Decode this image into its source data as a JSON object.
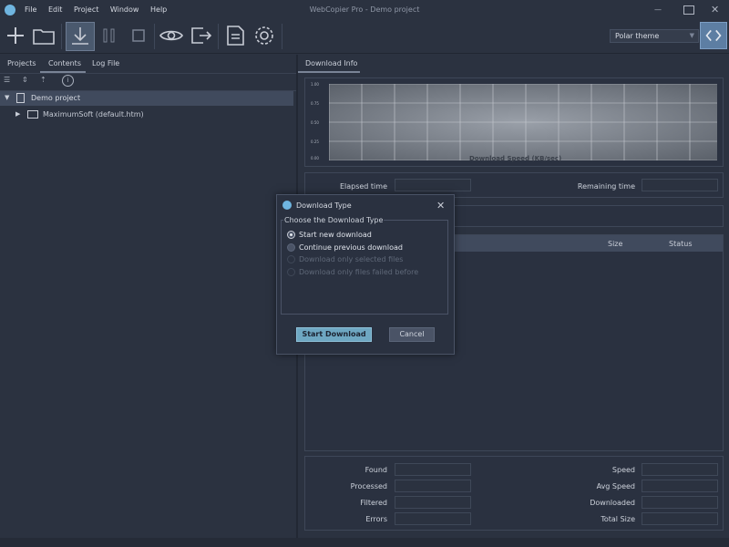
{
  "window": {
    "title": "WebCopier Pro - Demo project"
  },
  "menu": {
    "file": "File",
    "edit": "Edit",
    "project": "Project",
    "window": "Window",
    "help": "Help"
  },
  "toolbar": {
    "theme_select": "Polar theme"
  },
  "left_tabs": [
    "Projects",
    "Contents",
    "Log File"
  ],
  "tree": {
    "root": "Demo project",
    "child": "MaximumSoft (default.htm)"
  },
  "right": {
    "tab": "Download Info",
    "chart_title": "Download Speed (KB/sec)",
    "yticks": [
      "1.00",
      "0.75",
      "0.50",
      "0.25",
      "0.00"
    ],
    "elapsed": "Elapsed time",
    "remaining": "Remaining time",
    "col_size": "Size",
    "col_status": "Status"
  },
  "stats": {
    "found": "Found",
    "processed": "Processed",
    "filtered": "Filtered",
    "errors": "Errors",
    "speed": "Speed",
    "avg_speed": "Avg Speed",
    "downloaded": "Downloaded",
    "total_size": "Total Size"
  },
  "dialog": {
    "title": "Download Type",
    "group": "Choose the Download Type",
    "opt1": "Start new download",
    "opt2": "Continue previous download",
    "opt3": "Download only selected files",
    "opt4": "Download only files failed before",
    "start": "Start Download",
    "cancel": "Cancel"
  }
}
